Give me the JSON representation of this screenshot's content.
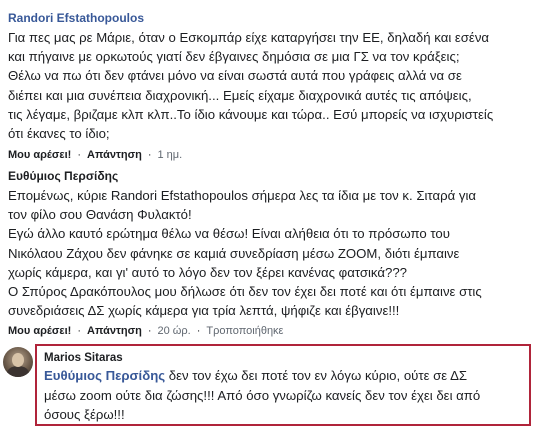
{
  "comment1": {
    "author": "Randori Efstathopoulos",
    "lines": [
      "Για πες μας ρε Μάριε, όταν ο Εσκομπάρ είχε καταργήσει την ΕΕ, δηλαδή και εσένα",
      "και πήγαινε με ορκωτούς γιατί δεν έβγαινες δημόσια σε μια ΓΣ να τον κράξεις;",
      "Θέλω να πω ότι δεν φτάνει μόνο να είναι σωστά αυτά που γράφεις αλλά να σε",
      "διέπει και μια συνέπεια διαχρονική... Εμείς είχαμε διαχρονικά αυτές τις απόψεις,",
      "τις λέγαμε, βριζαμε κλπ κλπ..Το ίδιο κάνουμε και τώρα.. Εσύ μπορείς να ισχυριστείς",
      "ότι έκανες το ίδιο;"
    ],
    "like_label": "Μου αρέσει!",
    "reply_label": "Απάντηση",
    "separator": "·",
    "time": "1 ημ."
  },
  "comment2": {
    "author": "Ευθύμιος Περσίδης",
    "lines": [
      "Επομένως, κύριε Randori Efstathopoulos σήμερα λες τα ίδια με τον κ. Σιταρά για",
      "τον φίλο σου Θανάση Φυλακτό!",
      "Εγώ άλλο καυτό ερώτημα θέλω να θέσω! Είναι αλήθεια ότι το πρόσωπο του",
      "Νικόλαου Ζάχου δεν φάνηκε σε καμιά συνεδρίαση μέσω ZOOM, διότι έμπαινε",
      "χωρίς κάμερα, και γι' αυτό το λόγο δεν τον ξέρει κανένας φατσικά???",
      "Ο Σπύρος Δρακόπουλος μου δήλωσε ότι δεν τον έχει δει ποτέ και ότι έμπαινε στις",
      "συνεδριάσεις ΔΣ χωρίς κάμερα για τρία λεπτά, ψήφιζε και έβγαινε!!!"
    ],
    "like_label": "Μου αρέσει!",
    "reply_label": "Απάντηση",
    "separator": "·",
    "time": "20 ώρ.",
    "edited": "Τροποποιήθηκε"
  },
  "reply": {
    "author": "Marios Sitaras",
    "mention": "Ευθύμιος Περσίδης",
    "line1_rest": " δεν τον έχω δει ποτέ τον εν λόγω κύριο, ούτε σε ΔΣ",
    "line2": "μέσω zoom ούτε δια ζώσης!!! Από όσο γνωρίζω κανείς δεν τον έχει δει από",
    "line3": "όσους ξέρω!!!",
    "highlight_color": "#b0243a"
  }
}
